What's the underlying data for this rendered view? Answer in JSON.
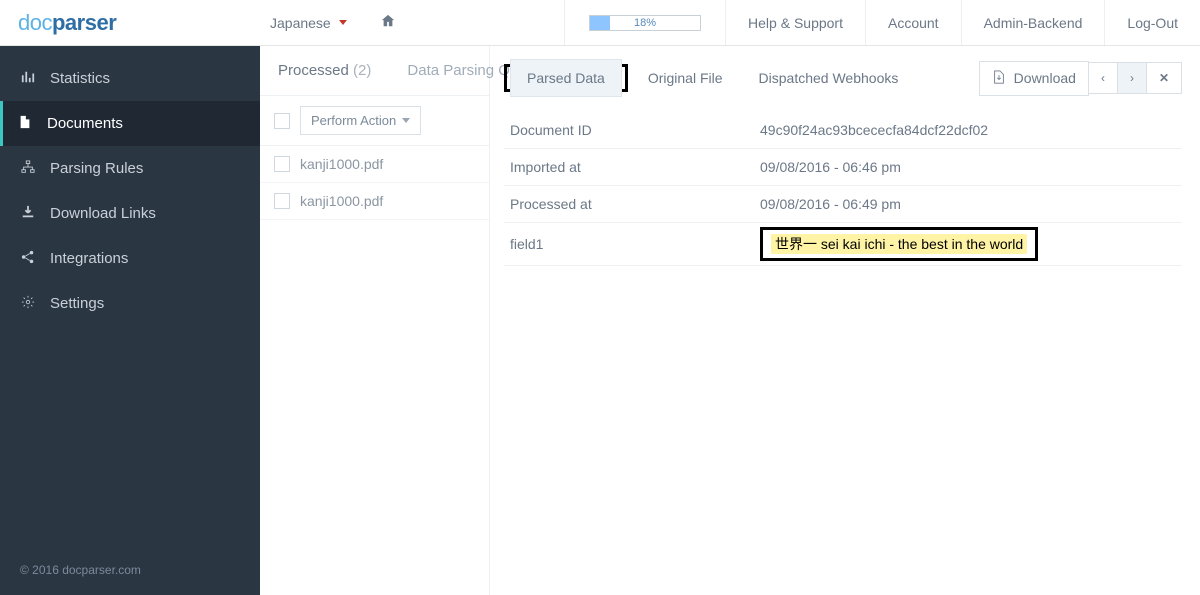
{
  "logo": {
    "part1": "doc",
    "part2": "parser"
  },
  "top": {
    "language": "Japanese",
    "progress_pct": 18,
    "progress_label": "18%",
    "links": {
      "help": "Help & Support",
      "account": "Account",
      "admin": "Admin-Backend",
      "logout": "Log-Out"
    }
  },
  "sidebar": {
    "items": [
      {
        "label": "Statistics"
      },
      {
        "label": "Documents"
      },
      {
        "label": "Parsing Rules"
      },
      {
        "label": "Download Links"
      },
      {
        "label": "Integrations"
      },
      {
        "label": "Settings"
      }
    ],
    "footer": "© 2016 docparser.com"
  },
  "mid": {
    "tabs": {
      "processed": "Processed",
      "processed_count": "(2)",
      "queue": "Data Parsing Q"
    },
    "action_label": "Perform Action",
    "docs": [
      {
        "name": "kanji1000.pdf"
      },
      {
        "name": "kanji1000.pdf"
      }
    ]
  },
  "right": {
    "subtabs": {
      "parsed": "Parsed Data",
      "original": "Original File",
      "webhooks": "Dispatched Webhooks"
    },
    "buttons": {
      "download": "Download"
    },
    "rows": [
      {
        "key": "Document ID",
        "value": "49c90f24ac93bcececfa84dcf22dcf02"
      },
      {
        "key": "Imported at",
        "value": "09/08/2016 - 06:46 pm"
      },
      {
        "key": "Processed at",
        "value": "09/08/2016 - 06:49 pm"
      },
      {
        "key": "field1",
        "value": "世界一 sei kai ichi - the best in the world"
      }
    ]
  }
}
